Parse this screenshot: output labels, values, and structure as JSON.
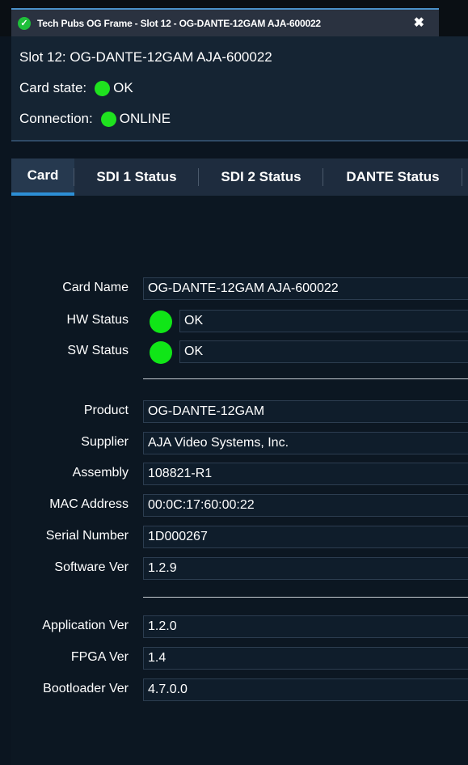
{
  "window": {
    "tab_title": "Tech Pubs OG Frame - Slot 12 - OG-DANTE-12GAM AJA-600022",
    "close_glyph": "✖",
    "check_glyph": "✓"
  },
  "header": {
    "slot_line": "Slot 12: OG-DANTE-12GAM AJA-600022",
    "card_state_label": "Card state:",
    "card_state_value": "OK",
    "connection_label": "Connection:",
    "connection_value": "ONLINE",
    "status_color": "#1fe21f"
  },
  "tabs": [
    {
      "label": "Card",
      "active": true
    },
    {
      "label": "SDI 1 Status",
      "active": false
    },
    {
      "label": "SDI 2 Status",
      "active": false
    },
    {
      "label": "DANTE Status",
      "active": false
    }
  ],
  "card": {
    "card_name_label": "Card Name",
    "card_name": "OG-DANTE-12GAM AJA-600022",
    "hw_status_label": "HW Status",
    "hw_status": "OK",
    "sw_status_label": "SW Status",
    "sw_status": "OK",
    "product_label": "Product",
    "product": "OG-DANTE-12GAM",
    "supplier_label": "Supplier",
    "supplier": "AJA Video Systems, Inc.",
    "assembly_label": "Assembly",
    "assembly": "108821-R1",
    "mac_label": "MAC Address",
    "mac": "00:0C:17:60:00:22",
    "serial_label": "Serial Number",
    "serial": "1D000267",
    "software_label": "Software Ver",
    "software": "1.2.9",
    "application_label": "Application Ver",
    "application": "1.2.0",
    "fpga_label": "FPGA Ver",
    "fpga": "1.4",
    "bootloader_label": "Bootloader Ver",
    "bootloader": "4.7.0.0"
  },
  "colors": {
    "accent": "#2d8fd6",
    "ok_led": "#10e617",
    "background": "#0c1722"
  }
}
